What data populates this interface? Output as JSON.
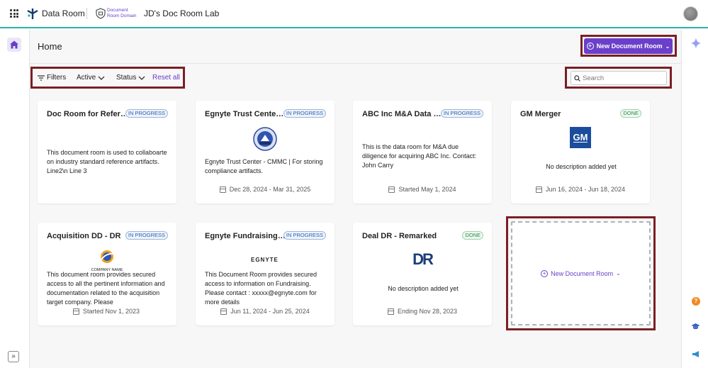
{
  "topbar": {
    "app_name": "Data Room",
    "domain_label_line1": "Document",
    "domain_label_line2": "Room Domain",
    "room_title": "JD's Doc Room Lab"
  },
  "header": {
    "page_title": "Home",
    "new_room_label": "New Document Room"
  },
  "filters": {
    "filters_label": "Filters",
    "active_label": "Active",
    "status_label": "Status",
    "reset_label": "Reset all"
  },
  "search": {
    "placeholder": "Search"
  },
  "colors": {
    "accent": "#6a3fc9",
    "highlight": "#7a1f24",
    "teal": "#2bb5a8"
  },
  "cards": [
    {
      "title": "Doc Room for Refere...",
      "status": "IN PROGRESS",
      "logo": "none",
      "description": "This document room is used to collaboarte on industry standard reference artifacts. Line2\\n Line 3",
      "date": ""
    },
    {
      "title": "Egnyte Trust Center ...",
      "status": "IN PROGRESS",
      "logo": "cmmc-badge-logo",
      "description": "Egnyte Trust Center - CMMC | For storing compliance artifacts.",
      "date": "Dec 28, 2024 - Mar 31, 2025"
    },
    {
      "title": "ABC Inc M&A Data R...",
      "status": "IN PROGRESS",
      "logo": "none",
      "description": "This is the data room for M&A due diligence for acquiring ABC Inc. Contact: John Carry",
      "date": "Started May 1, 2024"
    },
    {
      "title": "GM Merger",
      "status": "DONE",
      "logo": "gm-logo",
      "logo_text": "GM",
      "description": "No description added yet",
      "date": "Jun 16, 2024 - Jun 18, 2024"
    },
    {
      "title": "Acquisition DD - DR",
      "status": "IN PROGRESS",
      "logo": "company-logo",
      "logo_text": "COMPANY NAME",
      "description": "This document room provides secured access to all the pertinent information and documentation related to the acquisition target company. Please",
      "date": "Started Nov 1, 2023"
    },
    {
      "title": "Egnyte Fundraising D...",
      "status": "IN PROGRESS",
      "logo": "egnyte-logo",
      "logo_text": "EGNYTE",
      "description": "This Document Room provides secured access to information on Fundraising. Please contact : xxxxx@egnyte.com for more details",
      "date": "Jun 11, 2024 - Jun 25, 2024"
    },
    {
      "title": "Deal DR - Remarked",
      "status": "DONE",
      "logo": "dr-logo",
      "logo_text": "DR",
      "description": "No description added yet",
      "date": "Ending Nov 28, 2023"
    }
  ],
  "new_card": {
    "label": "New Document Room"
  }
}
